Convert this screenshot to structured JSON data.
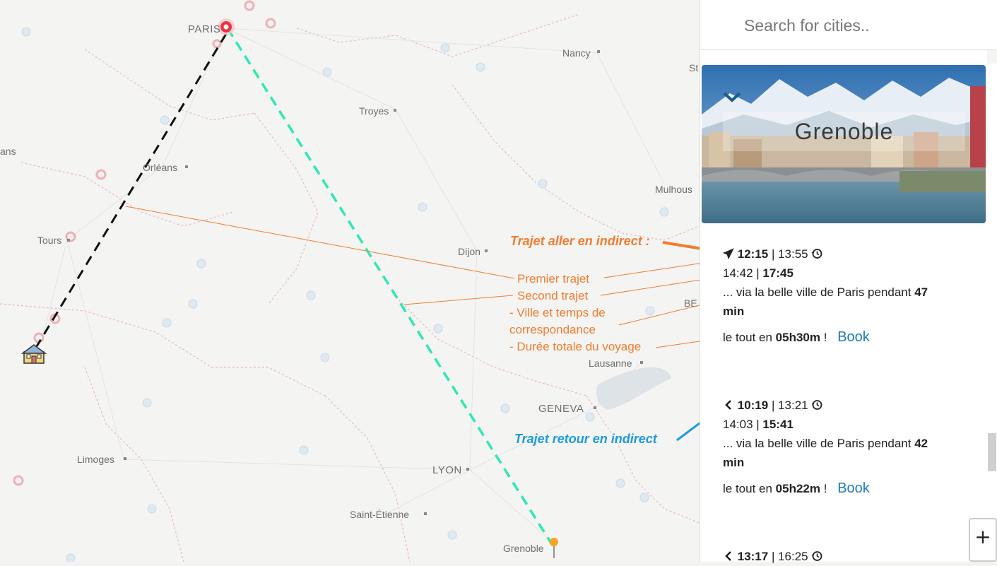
{
  "search": {
    "placeholder": "Search for cities.."
  },
  "destination": {
    "name": "Grenoble"
  },
  "map": {
    "cities": {
      "paris": "PARIS",
      "nancy": "Nancy",
      "troyes": "Troyes",
      "orleans": "Orléans",
      "tours": "Tours",
      "dijon": "Dijon",
      "mulhouse": "Mulhous",
      "lausanne": "Lausanne",
      "geneva": "GENEVA",
      "limoges": "Limoges",
      "lyon": "LYON",
      "saint_etienne": "Saint-Étienne",
      "grenoble": "Grenoble",
      "ans": "ans",
      "be": "BE",
      "st": "St"
    }
  },
  "annotations": {
    "aller_title": "Trajet aller en indirect :",
    "premier": "Premier trajet",
    "second": "Second trajet",
    "ville_line1": "- Ville et temps de",
    "ville_line2": "correspondance",
    "duree": "- Durée totale du voyage",
    "retour_title": "Trajet retour en indirect"
  },
  "trips": [
    {
      "dep1": "12:15",
      "sep1": " | ",
      "arr1": "13:55",
      "dep2": "14:42",
      "sep2": " | ",
      "arr2": "17:45",
      "via_prefix": "... via la belle ville de Paris pendant ",
      "via_num": "47",
      "via_unit": "min",
      "total_prefix": "le tout en ",
      "total": "05h30m",
      "total_suffix": " !",
      "book": "Book"
    },
    {
      "dep1": "10:19",
      "sep1": " | ",
      "arr1": "13:21",
      "dep2": "14:03",
      "sep2": " | ",
      "arr2": "15:41",
      "via_prefix": "... via la belle ville de Paris pendant ",
      "via_num": "42",
      "via_unit": "min",
      "total_prefix": "le tout en ",
      "total": "05h22m",
      "total_suffix": " !",
      "book": "Book"
    },
    {
      "dep1": "13:17",
      "sep1": " | ",
      "arr1": "16:25"
    }
  ],
  "zoom": {
    "plus": "+"
  },
  "colors": {
    "accent": "#f07d2f",
    "blue": "#1a9be0",
    "route_green": "#2ee8b6",
    "link": "#1a7bbd"
  }
}
